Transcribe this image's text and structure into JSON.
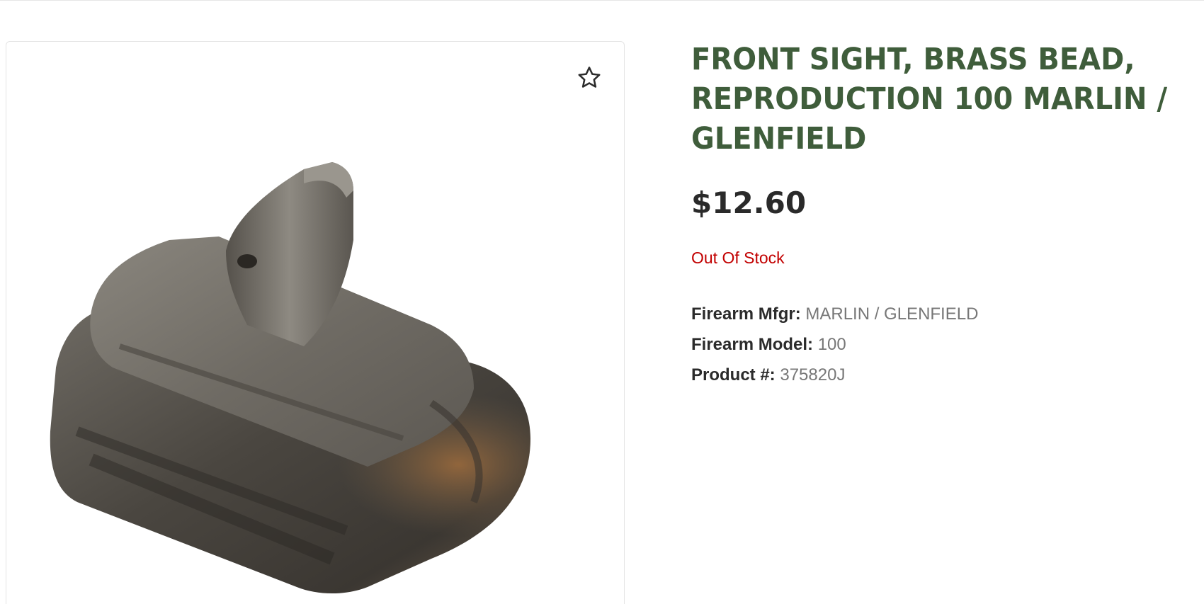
{
  "product": {
    "title": "FRONT SIGHT, BRASS BEAD, REPRODUCTION 100 MARLIN / GLENFIELD",
    "price": "$12.60",
    "stock_status": "Out Of Stock",
    "image_alt": "Front sight part photo",
    "specs": [
      {
        "label": "Firearm Mfgr:",
        "value": "MARLIN / GLENFIELD"
      },
      {
        "label": "Firearm Model:",
        "value": "100"
      },
      {
        "label": "Product #:",
        "value": "375820J"
      }
    ]
  },
  "icons": {
    "wishlist": "star-outline-icon"
  },
  "colors": {
    "title": "#3f5d3b",
    "price": "#2a2a2a",
    "stock": "#c20000",
    "spec_value": "#777777"
  }
}
